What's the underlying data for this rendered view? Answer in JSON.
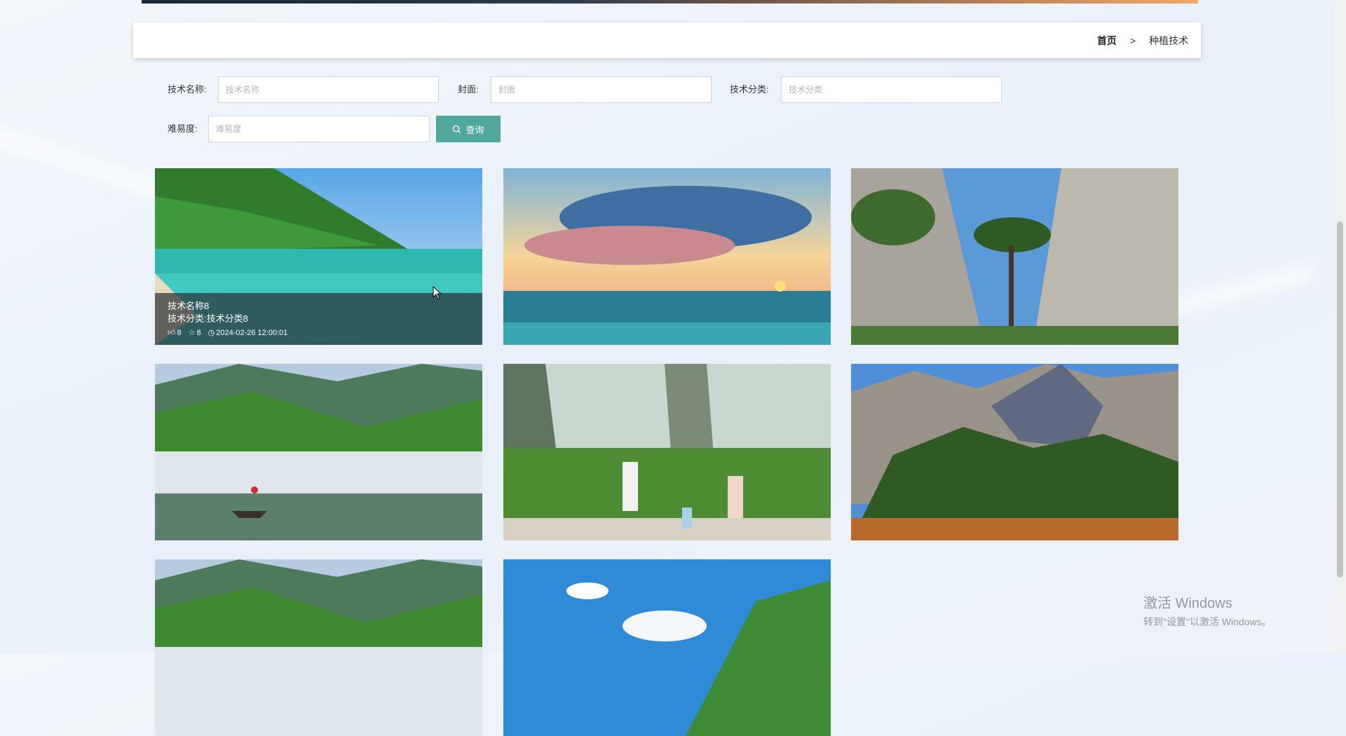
{
  "breadcrumb": {
    "home": "首页",
    "separator": ">",
    "current": "种植技术"
  },
  "search": {
    "fields": [
      {
        "label": "技术名称:",
        "placeholder": "技术名称"
      },
      {
        "label": "封面:",
        "placeholder": "封面"
      },
      {
        "label": "技术分类:",
        "placeholder": "技术分类"
      },
      {
        "label": "难易度:",
        "placeholder": "难易度"
      }
    ],
    "query_button": "查询"
  },
  "cards": [
    {
      "scene": "beach-mountain",
      "title": "技术名称8",
      "category": "技术分类:技术分类8",
      "likes": "8",
      "favorites": "8",
      "time": "2024-02-26 12:00:01"
    },
    {
      "scene": "sunset-sea"
    },
    {
      "scene": "pine-cliff"
    },
    {
      "scene": "misty-lake-boat"
    },
    {
      "scene": "family-forest"
    },
    {
      "scene": "rocky-mountain"
    },
    {
      "scene": "misty-lake"
    },
    {
      "scene": "blue-sky-hill"
    }
  ],
  "watermark": {
    "title": "激活 Windows",
    "subtitle": "转到\"设置\"以激活 Windows。"
  },
  "colors": {
    "accent": "#52a79c",
    "overlay": "#2d3237"
  }
}
